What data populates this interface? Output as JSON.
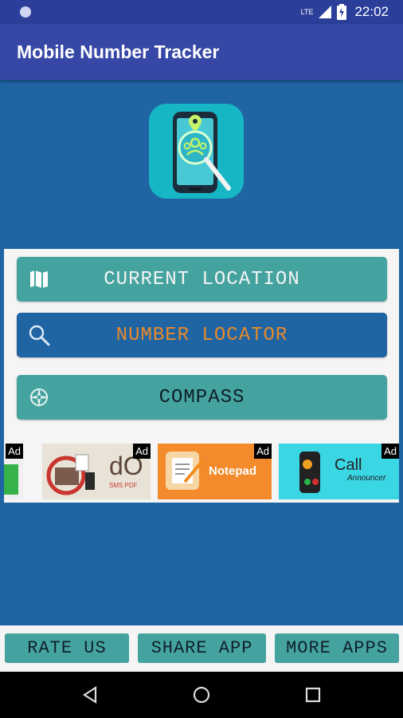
{
  "status_bar": {
    "network": "LTE",
    "time": "22:02"
  },
  "app_bar": {
    "title": "Mobile Number Tracker"
  },
  "colors": {
    "primary": "#3647a5",
    "teal": "#45a39f",
    "blue_btn": "#1f64a3",
    "orange_text": "#e98a2b"
  },
  "menu": {
    "current_location": "CURRENT LOCATION",
    "number_locator": "NUMBER LOCATOR",
    "compass": "COMPASS"
  },
  "ads": {
    "badge": "Ad",
    "items": [
      {
        "name": "pdf-app",
        "text": "dO",
        "subtext": "SMS PDF"
      },
      {
        "name": "notepad-app",
        "text": "Notepad"
      },
      {
        "name": "call-announcer-app",
        "text_big": "Call",
        "text_small": "Announcer"
      }
    ]
  },
  "bottom": {
    "rate_us": "RATE US",
    "share_app": "SHARE APP",
    "more_apps": "MORE APPS"
  }
}
